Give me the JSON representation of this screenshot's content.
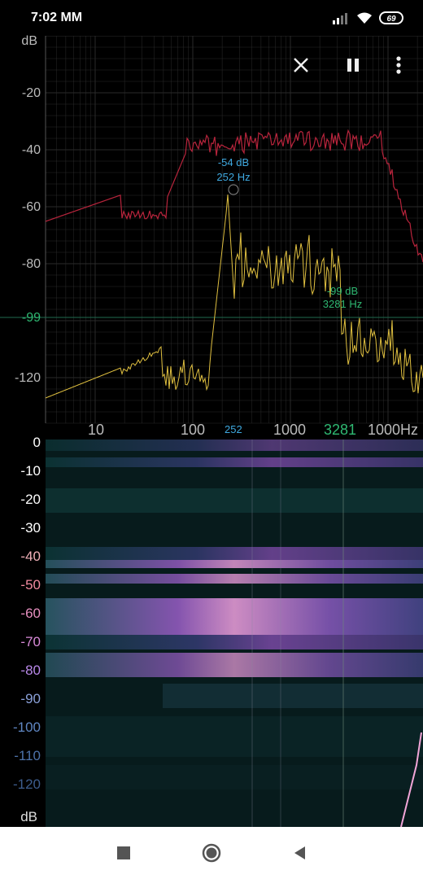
{
  "status_bar": {
    "time": "7:02 MM",
    "battery": "69",
    "icons": [
      "signal-icon",
      "wifi-icon",
      "battery-icon"
    ]
  },
  "spectrum": {
    "y_unit": "dB",
    "y_ticks": [
      "-20",
      "-40",
      "-60",
      "-80",
      "-99",
      "-120"
    ],
    "x_ticks": [
      "10",
      "100",
      "1000",
      "1000Hz"
    ],
    "cursor_x_label": "252",
    "marker_x_label": "3281",
    "peak_annotation": {
      "db": "-54 dB",
      "hz": "252 Hz"
    },
    "marker_annotation": {
      "db": "-99 dB",
      "hz": "3281 Hz"
    },
    "threshold_label": "-99",
    "colors": {
      "peak_hold": "#b8243c",
      "live": "#e0c040",
      "peak_label": "#3fa9e0",
      "marker_label": "#2fb872",
      "grid": "#2a2a2a"
    }
  },
  "spectrogram": {
    "y_unit": "dB",
    "y_ticks": [
      "0",
      "-10",
      "-20",
      "-30",
      "-40",
      "-50",
      "-60",
      "-70",
      "-80",
      "-90",
      "-100",
      "-110",
      "-120"
    ],
    "tick_colors": [
      "#ffffff",
      "#ffffff",
      "#ffffff",
      "#ffffff",
      "#f0b0b8",
      "#f28aa0",
      "#e890c0",
      "#d88ad8",
      "#b888e8",
      "#8aa0d8",
      "#5f86c2",
      "#4d72a8",
      "#3d5d8e"
    ]
  },
  "controls": {
    "close": "close-icon",
    "pause": "pause-icon",
    "menu": "more-vert-icon"
  },
  "nav": {
    "recents": "square-icon",
    "home": "circle-icon",
    "back": "triangle-back-icon"
  }
}
